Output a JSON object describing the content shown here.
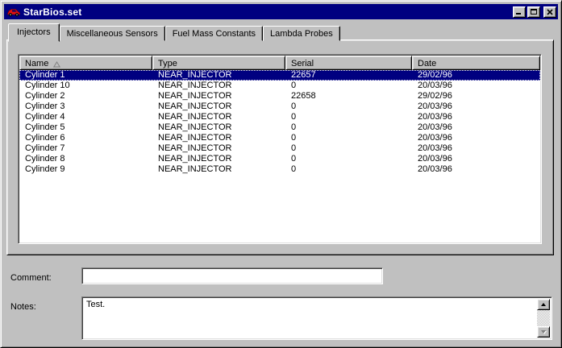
{
  "window": {
    "title": "StarBios.set",
    "icon": "red-car-icon"
  },
  "tabs": [
    {
      "label": "Injectors",
      "active": true
    },
    {
      "label": "Miscellaneous Sensors",
      "active": false
    },
    {
      "label": "Fuel Mass Constants",
      "active": false
    },
    {
      "label": "Lambda Probes",
      "active": false
    }
  ],
  "list": {
    "columns": [
      {
        "label": "Name",
        "sort": "asc"
      },
      {
        "label": "Type",
        "sort": null
      },
      {
        "label": "Serial",
        "sort": null
      },
      {
        "label": "Date",
        "sort": null
      }
    ],
    "rows": [
      {
        "name": "Cylinder 1",
        "type": "NEAR_INJECTOR",
        "serial": "22657",
        "date": "29/02/96",
        "selected": true
      },
      {
        "name": "Cylinder 10",
        "type": "NEAR_INJECTOR",
        "serial": "0",
        "date": "20/03/96",
        "selected": false
      },
      {
        "name": "Cylinder 2",
        "type": "NEAR_INJECTOR",
        "serial": "22658",
        "date": "29/02/96",
        "selected": false
      },
      {
        "name": "Cylinder 3",
        "type": "NEAR_INJECTOR",
        "serial": "0",
        "date": "20/03/96",
        "selected": false
      },
      {
        "name": "Cylinder 4",
        "type": "NEAR_INJECTOR",
        "serial": "0",
        "date": "20/03/96",
        "selected": false
      },
      {
        "name": "Cylinder 5",
        "type": "NEAR_INJECTOR",
        "serial": "0",
        "date": "20/03/96",
        "selected": false
      },
      {
        "name": "Cylinder 6",
        "type": "NEAR_INJECTOR",
        "serial": "0",
        "date": "20/03/96",
        "selected": false
      },
      {
        "name": "Cylinder 7",
        "type": "NEAR_INJECTOR",
        "serial": "0",
        "date": "20/03/96",
        "selected": false
      },
      {
        "name": "Cylinder 8",
        "type": "NEAR_INJECTOR",
        "serial": "0",
        "date": "20/03/96",
        "selected": false
      },
      {
        "name": "Cylinder 9",
        "type": "NEAR_INJECTOR",
        "serial": "0",
        "date": "20/03/96",
        "selected": false
      }
    ]
  },
  "fields": {
    "comment_label": "Comment:",
    "comment_value": "",
    "notes_label": "Notes:",
    "notes_value": "Test."
  },
  "colors": {
    "titlebar": "#000080",
    "selection": "#000080",
    "chrome": "#c0c0c0"
  }
}
